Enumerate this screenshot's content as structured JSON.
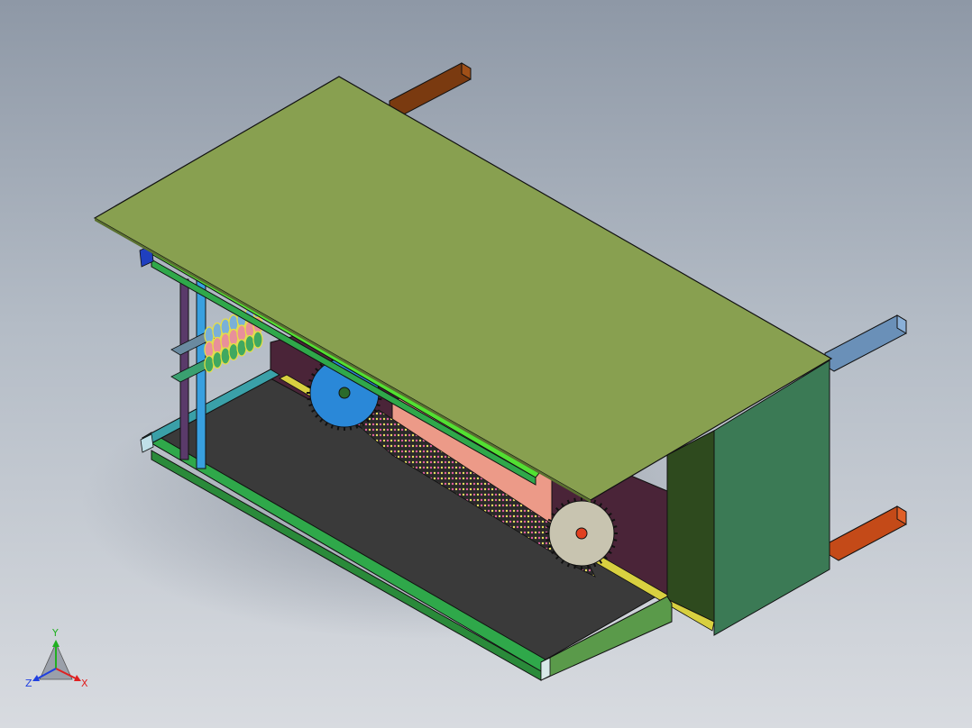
{
  "viewport": {
    "background_top": "#8e98a6",
    "background_bottom": "#d8dbe0"
  },
  "model": {
    "colors": {
      "top_plate": "#88a050",
      "end_box_front": "#3b7a55",
      "end_box_inner": "#2e4a1e",
      "floor": "#3a3a3a",
      "rail_front": "#2fa84a",
      "rail_top_edge": "#52e032",
      "rail_side": "#4a8a3a",
      "back_panel": "#4a2438",
      "chain_guard": "#ec9a88",
      "sprocket_blue": "#2a88d8",
      "sprocket_gray": "#c8c4b0",
      "sprocket_hub_green": "#2a6a2a",
      "sprocket_hub_red": "#e04020",
      "rod_brown": "#7a3a10",
      "rod_blue": "#6a90b8",
      "rod_orange": "#c44a18",
      "post_purple": "#5a3a6a",
      "post_cyan": "#38a0e0",
      "yellow_edge": "#d8d040",
      "cyan_frame": "#3aa0a8"
    }
  },
  "triad": {
    "x_label": "X",
    "y_label": "Y",
    "z_label": "Z",
    "x_color": "#e02020",
    "y_color": "#20b020",
    "z_color": "#2040e0"
  }
}
